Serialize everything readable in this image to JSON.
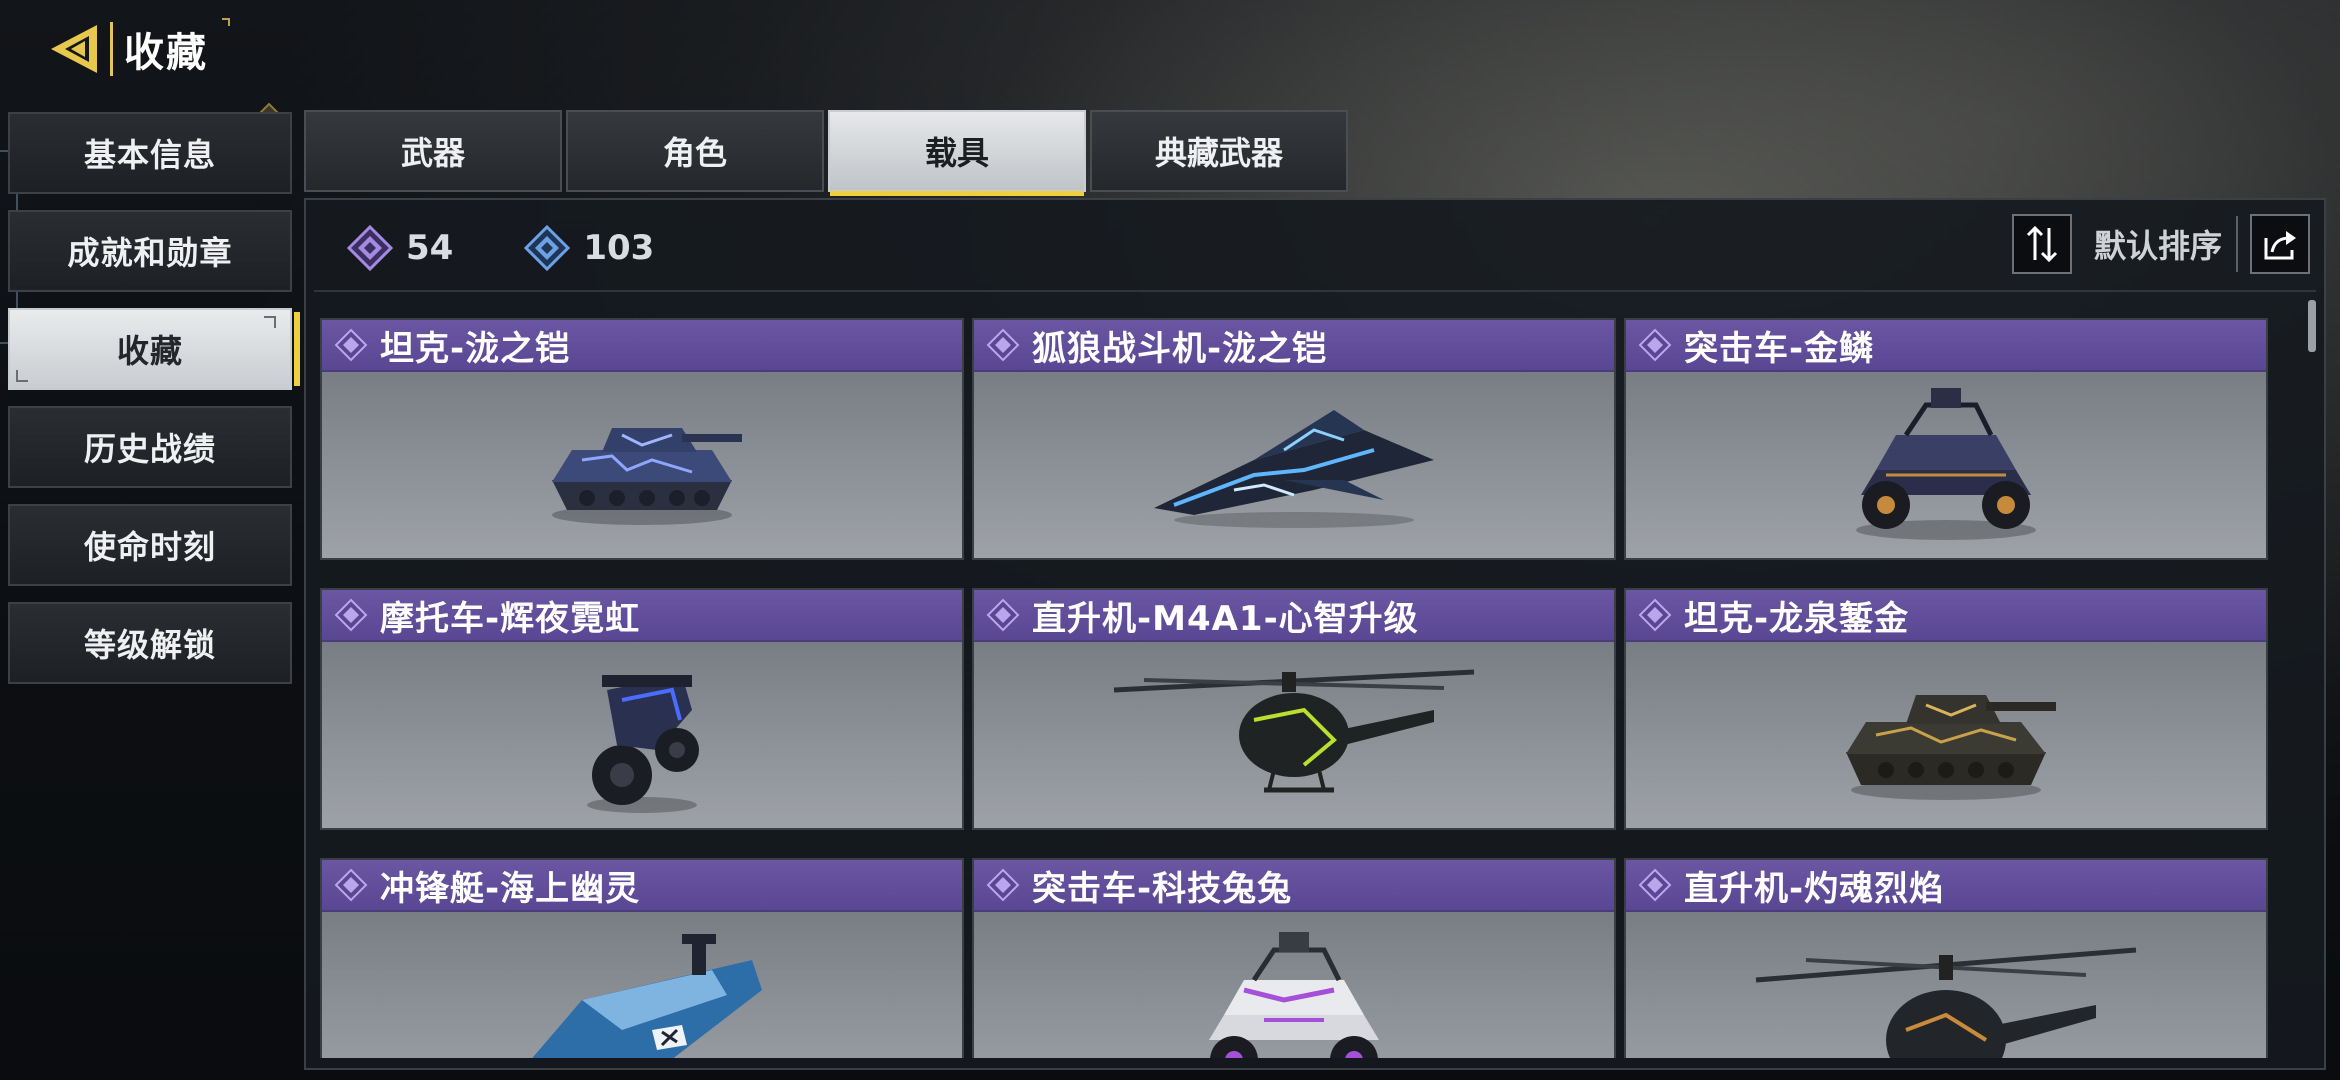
{
  "header": {
    "title": "收藏",
    "back_icon": "back-arrow-icon",
    "accent": "#e2c55a"
  },
  "sidebar": {
    "items": [
      {
        "label": "基本信息",
        "active": false
      },
      {
        "label": "成就和勋章",
        "active": false
      },
      {
        "label": "收藏",
        "active": true
      },
      {
        "label": "历史战绩",
        "active": false
      },
      {
        "label": "使命时刻",
        "active": false
      },
      {
        "label": "等级解锁",
        "active": false
      }
    ]
  },
  "tabs": [
    {
      "label": "武器",
      "active": false
    },
    {
      "label": "角色",
      "active": false
    },
    {
      "label": "载具",
      "active": true
    },
    {
      "label": "典藏武器",
      "active": false
    }
  ],
  "stats": [
    {
      "icon": "purple-diamond-icon",
      "value": "54",
      "color": "#a58be0"
    },
    {
      "icon": "blue-diamond-icon",
      "value": "103",
      "color": "#6ea0e6"
    }
  ],
  "sort": {
    "label": "默认排序",
    "sort_icon": "sort-toggle-icon",
    "share_icon": "share-icon"
  },
  "items": [
    {
      "name": "坦克-泷之铠",
      "rarity_color": "#6a56a3",
      "art": "tank"
    },
    {
      "name": "狐狼战斗机-泷之铠",
      "rarity_color": "#6a56a3",
      "art": "jet"
    },
    {
      "name": "突击车-金鳞",
      "rarity_color": "#6a56a3",
      "art": "buggy"
    },
    {
      "name": "摩托车-辉夜霓虹",
      "rarity_color": "#6a56a3",
      "art": "motorcycle"
    },
    {
      "name": "直升机-M4A1-心智升级",
      "rarity_color": "#6a56a3",
      "art": "helicopter"
    },
    {
      "name": "坦克-龙泉錾金",
      "rarity_color": "#6a56a3",
      "art": "tank"
    },
    {
      "name": "冲锋艇-海上幽灵",
      "rarity_color": "#6a56a3",
      "art": "boat"
    },
    {
      "name": "突击车-科技兔兔",
      "rarity_color": "#6a56a3",
      "art": "buggy"
    },
    {
      "name": "直升机-灼魂烈焰",
      "rarity_color": "#6a56a3",
      "art": "helicopter"
    }
  ]
}
